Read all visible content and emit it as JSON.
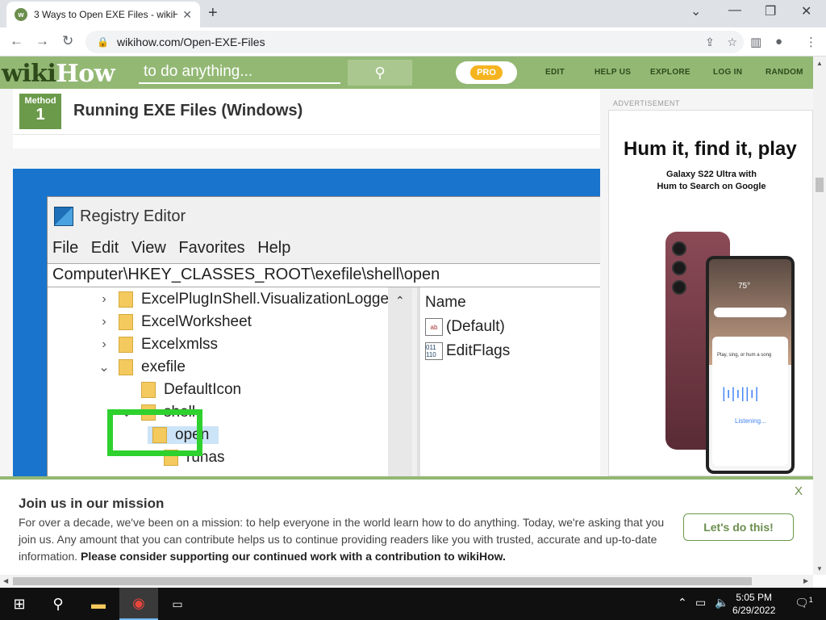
{
  "browser": {
    "tab_title": "3 Ways to Open EXE Files - wikiHow",
    "url": "wikihow.com/Open-EXE-Files"
  },
  "wikihow": {
    "logo_wiki": "wiki",
    "logo_how": "How",
    "search_placeholder": "to do anything...",
    "pro_label": "PRO",
    "nav": [
      "EDIT",
      "HELP US",
      "EXPLORE",
      "LOG IN",
      "RANDOM"
    ]
  },
  "method": {
    "label": "Method",
    "number": "1",
    "title": "Running EXE Files (Windows)"
  },
  "registry_editor": {
    "title": "Registry Editor",
    "menu": [
      "File",
      "Edit",
      "View",
      "Favorites",
      "Help"
    ],
    "path": "Computer\\HKEY_CLASSES_ROOT\\exefile\\shell\\open",
    "tree": [
      "ExcelPlugInShell.VisualizationLogge",
      "ExcelWorksheet",
      "Excelxmlss",
      "exefile",
      "DefaultIcon",
      "shell",
      "open",
      "runas"
    ],
    "list_header": "Name",
    "list": [
      {
        "icon": "ab",
        "name": "(Default)"
      },
      {
        "icon": "011 110",
        "name": "EditFlags"
      }
    ]
  },
  "ad": {
    "label": "ADVERTISEMENT",
    "headline": "Hum it, find it, play",
    "sub_line1": "Galaxy S22 Ultra with",
    "sub_line2": "Hum to Search on Google",
    "temp": "75°",
    "prompt": "Play, sing, or hum a song",
    "listening": "Listening..."
  },
  "banner": {
    "heading": "Join us in our mission",
    "body": "For over a decade, we've been on a mission: to help everyone in the world learn how to do anything. Today, we're asking that you join us. Any amount that you can contribute helps us to continue providing readers like you with trusted, accurate and up-to-date information.",
    "body_bold": "Please consider supporting our continued work with a contribution to wikiHow.",
    "button": "Let's do this!",
    "close": "X"
  },
  "taskbar": {
    "time": "5:05 PM",
    "date": "6/29/2022",
    "notification_count": "1"
  }
}
